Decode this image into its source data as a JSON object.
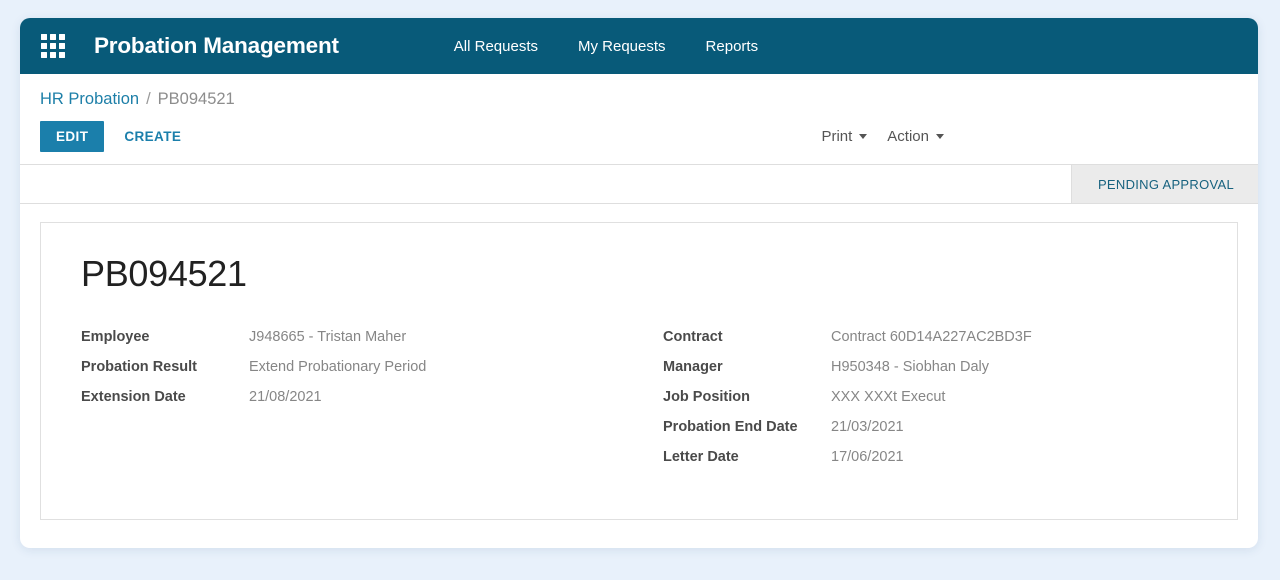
{
  "topnav": {
    "menu_icon": "grid-icon",
    "title": "Probation Management",
    "links": [
      {
        "label": "All Requests"
      },
      {
        "label": "My Requests"
      },
      {
        "label": "Reports"
      }
    ]
  },
  "breadcrumb": {
    "root": "HR Probation",
    "separator": "/",
    "current": "PB094521"
  },
  "toolbar": {
    "edit_label": "EDIT",
    "create_label": "CREATE",
    "print_label": "Print",
    "action_label": "Action"
  },
  "status": {
    "label": "PENDING APPROVAL"
  },
  "record": {
    "id": "PB094521",
    "left_fields": [
      {
        "label": "Employee",
        "value": "J948665 - Tristan Maher"
      },
      {
        "label": "Probation Result",
        "value": "Extend Probationary Period"
      },
      {
        "label": "Extension Date",
        "value": "21/08/2021"
      }
    ],
    "right_fields": [
      {
        "label": "Contract",
        "value": "Contract 60D14A227AC2BD3F"
      },
      {
        "label": "Manager",
        "value": "H950348 - Siobhan Daly"
      },
      {
        "label": "Job Position",
        "value": "XXX XXXt Execut"
      },
      {
        "label": "Probation End Date",
        "value": "21/03/2021"
      },
      {
        "label": "Letter Date",
        "value": "17/06/2021"
      }
    ]
  },
  "colors": {
    "header_teal": "#085a79",
    "accent_blue": "#1b7fab",
    "status_text": "#17627f",
    "status_bg": "#ebebeb",
    "page_bg": "#e8f1fb"
  }
}
